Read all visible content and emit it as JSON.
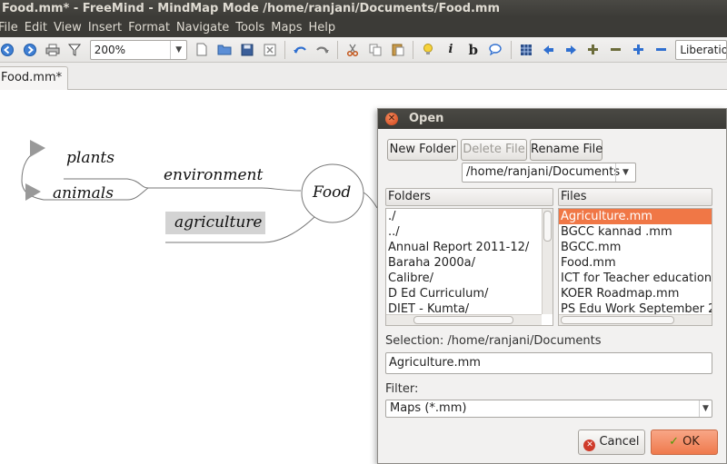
{
  "window": {
    "title": "Food.mm* - FreeMind - MindMap Mode /home/ranjani/Documents/Food.mm"
  },
  "menu": [
    "File",
    "Edit",
    "View",
    "Insert",
    "Format",
    "Navigate",
    "Tools",
    "Maps",
    "Help"
  ],
  "toolbar": {
    "zoom_value": "200%",
    "font_value": "Liberation"
  },
  "tabs": {
    "active": "Food.mm*"
  },
  "mindmap": {
    "root": "Food",
    "nodes": {
      "environment": "environment",
      "agriculture": "agriculture",
      "plants": "plants",
      "animals": "animals"
    }
  },
  "dialog": {
    "title": "Open",
    "new_folder": "New Folder",
    "delete_file": "Delete File",
    "rename_file": "Rename File",
    "path": "/home/ranjani/Documents",
    "folders_header": "Folders",
    "files_header": "Files",
    "folders": [
      "./",
      "../",
      "Annual Report 2011-12/",
      "Baraha 2000a/",
      "Calibre/",
      "D Ed Curriculum/",
      "DIET - Kumta/"
    ],
    "files": [
      "Agriculture.mm",
      "BGCC kannad .mm",
      "BGCC.mm",
      "Food.mm",
      "ICT for Teacher education",
      "KOER Roadmap.mm",
      "PS Edu Work September 2"
    ],
    "selection_label": "Selection: /home/ranjani/Documents",
    "selection_value": "Agriculture.mm",
    "filter_label": "Filter:",
    "filter_value": "Maps (*.mm)",
    "cancel": "Cancel",
    "ok": "OK"
  }
}
